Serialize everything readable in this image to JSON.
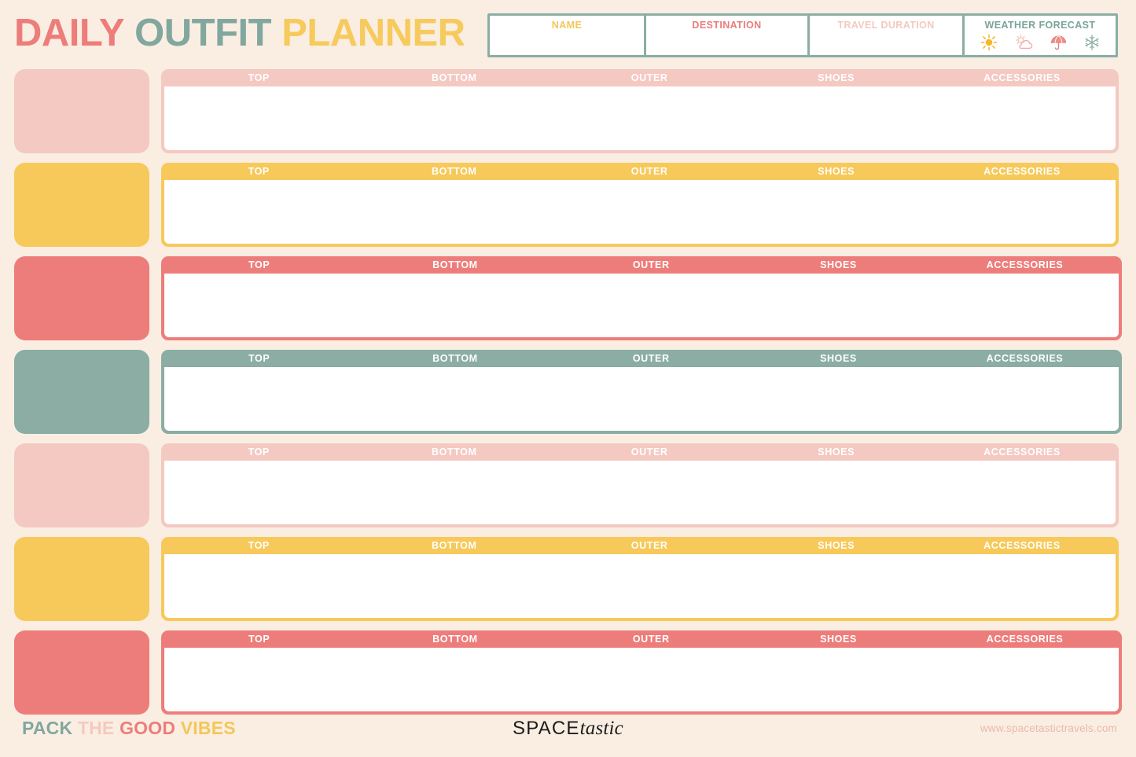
{
  "title": {
    "part1": "DAILY",
    "part2": "OUTFIT",
    "part3": "PLANNER"
  },
  "header_fields": {
    "name": {
      "label": "NAME",
      "value": "",
      "placeholder": ""
    },
    "destination": {
      "label": "DESTINATION",
      "value": "",
      "placeholder": ""
    },
    "duration": {
      "label": "TRAVEL DURATION",
      "value": "",
      "placeholder": ""
    },
    "weather": {
      "label": "WEATHER FORECAST",
      "icons": [
        "sun-icon",
        "sun-behind-cloud-icon",
        "umbrella-icon",
        "snowflake-icon"
      ]
    }
  },
  "columns": [
    "TOP",
    "BOTTOM",
    "OUTER",
    "SHOES",
    "ACCESSORIES"
  ],
  "rows": [
    {
      "color": "c-pink",
      "width": "narrow",
      "day_label": "",
      "cells": [
        "",
        "",
        "",
        "",
        ""
      ]
    },
    {
      "color": "c-yellow",
      "width": "narrow",
      "day_label": "",
      "cells": [
        "",
        "",
        "",
        "",
        ""
      ]
    },
    {
      "color": "c-coral",
      "width": "wide",
      "day_label": "",
      "cells": [
        "",
        "",
        "",
        "",
        ""
      ]
    },
    {
      "color": "c-sage",
      "width": "wide",
      "day_label": "",
      "cells": [
        "",
        "",
        "",
        "",
        ""
      ]
    },
    {
      "color": "c-pink",
      "width": "narrow",
      "day_label": "",
      "cells": [
        "",
        "",
        "",
        "",
        ""
      ]
    },
    {
      "color": "c-yellow",
      "width": "narrow",
      "day_label": "",
      "cells": [
        "",
        "",
        "",
        "",
        ""
      ]
    },
    {
      "color": "c-coral",
      "width": "wide",
      "day_label": "",
      "cells": [
        "",
        "",
        "",
        "",
        ""
      ]
    }
  ],
  "footer": {
    "tagline": {
      "word1": "PACK",
      "word2": "THE",
      "word3": "GOOD",
      "word4": "VIBES"
    },
    "brand": {
      "part1": "SPACE",
      "part2": "tastic"
    },
    "url": "www.spacetastictravels.com"
  },
  "colors": {
    "background": "#faeee2",
    "coral": "#ed7d7b",
    "sage": "#81a79f",
    "yellow": "#f3c759",
    "light_pink": "#f4c9c2",
    "white": "#ffffff",
    "url_pink": "#eab9ab"
  }
}
